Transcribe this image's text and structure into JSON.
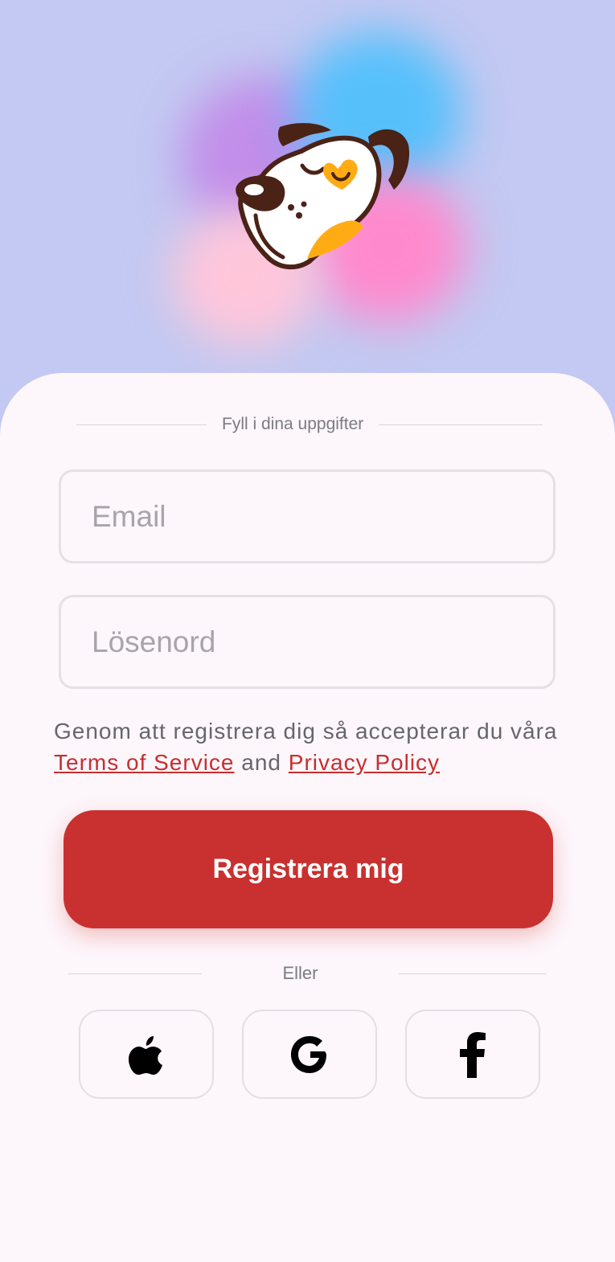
{
  "form": {
    "section_label": "Fyll i dina uppgifter",
    "email_placeholder": "Email",
    "password_placeholder": "Lösenord"
  },
  "terms": {
    "prefix": "Genom att registrera dig så accepterar du våra ",
    "terms_link": "Terms of Service",
    "connector": " and ",
    "privacy_link": "Privacy Policy"
  },
  "actions": {
    "register_label": "Registrera mig",
    "or_label": "Eller"
  },
  "social": [
    {
      "icon": "apple-icon"
    },
    {
      "icon": "google-icon"
    },
    {
      "icon": "facebook-icon"
    }
  ],
  "colors": {
    "accent": "#c8312f",
    "hero_background": "#c3c9f2",
    "card_background": "#fdf6fb"
  }
}
